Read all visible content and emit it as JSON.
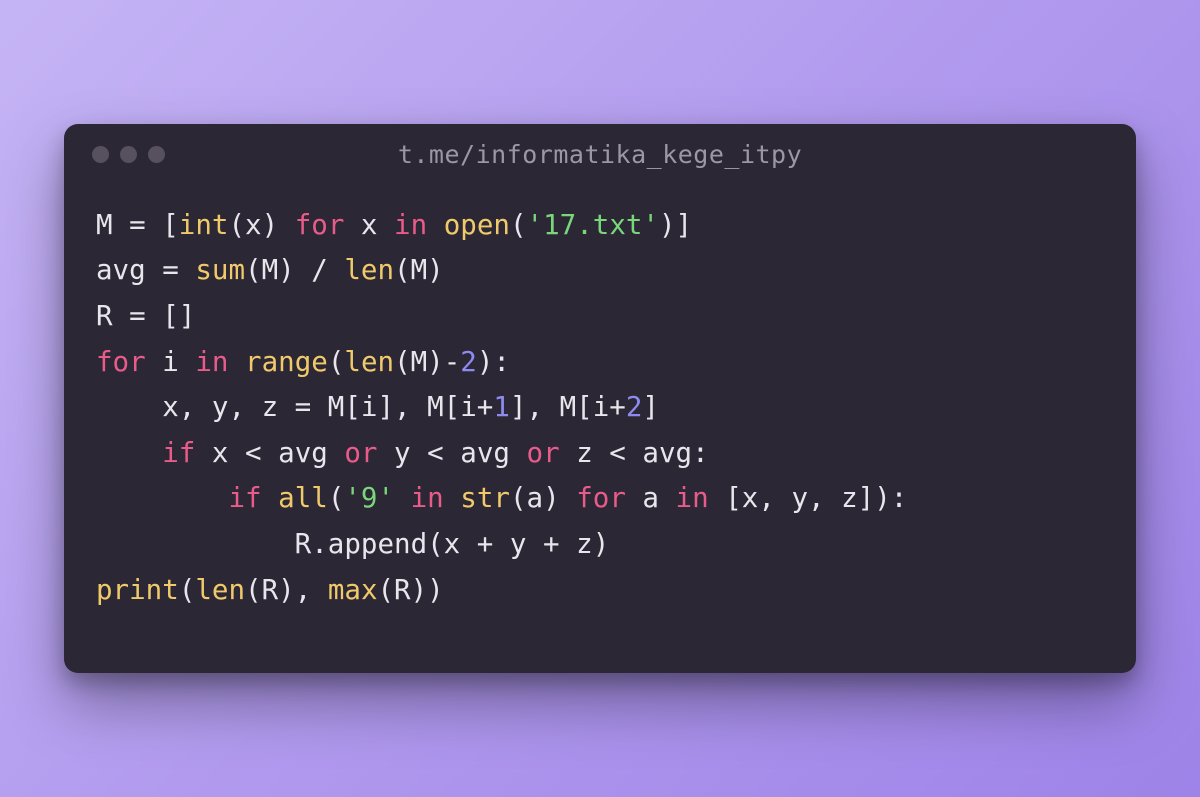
{
  "window": {
    "title": "t.me/informatika_kege_itpy"
  },
  "code": {
    "lines": [
      [
        {
          "t": "M = [",
          "c": "default"
        },
        {
          "t": "int",
          "c": "func"
        },
        {
          "t": "(x) ",
          "c": "default"
        },
        {
          "t": "for",
          "c": "keyword"
        },
        {
          "t": " x ",
          "c": "default"
        },
        {
          "t": "in",
          "c": "keyword"
        },
        {
          "t": " ",
          "c": "default"
        },
        {
          "t": "open",
          "c": "func"
        },
        {
          "t": "(",
          "c": "default"
        },
        {
          "t": "'17.txt'",
          "c": "string"
        },
        {
          "t": ")]",
          "c": "default"
        }
      ],
      [
        {
          "t": "avg = ",
          "c": "default"
        },
        {
          "t": "sum",
          "c": "func"
        },
        {
          "t": "(M) / ",
          "c": "default"
        },
        {
          "t": "len",
          "c": "func"
        },
        {
          "t": "(M)",
          "c": "default"
        }
      ],
      [
        {
          "t": "R = []",
          "c": "default"
        }
      ],
      [
        {
          "t": "for",
          "c": "keyword"
        },
        {
          "t": " i ",
          "c": "default"
        },
        {
          "t": "in",
          "c": "keyword"
        },
        {
          "t": " ",
          "c": "default"
        },
        {
          "t": "range",
          "c": "func"
        },
        {
          "t": "(",
          "c": "default"
        },
        {
          "t": "len",
          "c": "func"
        },
        {
          "t": "(M)-",
          "c": "default"
        },
        {
          "t": "2",
          "c": "number"
        },
        {
          "t": "):",
          "c": "default"
        }
      ],
      [
        {
          "t": "    x, y, z = M[i], M[i+",
          "c": "default"
        },
        {
          "t": "1",
          "c": "number"
        },
        {
          "t": "], M[i+",
          "c": "default"
        },
        {
          "t": "2",
          "c": "number"
        },
        {
          "t": "]",
          "c": "default"
        }
      ],
      [
        {
          "t": "    ",
          "c": "default"
        },
        {
          "t": "if",
          "c": "keyword"
        },
        {
          "t": " x < avg ",
          "c": "default"
        },
        {
          "t": "or",
          "c": "keyword"
        },
        {
          "t": " y < avg ",
          "c": "default"
        },
        {
          "t": "or",
          "c": "keyword"
        },
        {
          "t": " z < avg:",
          "c": "default"
        }
      ],
      [
        {
          "t": "        ",
          "c": "default"
        },
        {
          "t": "if",
          "c": "keyword"
        },
        {
          "t": " ",
          "c": "default"
        },
        {
          "t": "all",
          "c": "func"
        },
        {
          "t": "(",
          "c": "default"
        },
        {
          "t": "'9'",
          "c": "string"
        },
        {
          "t": " ",
          "c": "default"
        },
        {
          "t": "in",
          "c": "keyword"
        },
        {
          "t": " ",
          "c": "default"
        },
        {
          "t": "str",
          "c": "func"
        },
        {
          "t": "(a) ",
          "c": "default"
        },
        {
          "t": "for",
          "c": "keyword"
        },
        {
          "t": " a ",
          "c": "default"
        },
        {
          "t": "in",
          "c": "keyword"
        },
        {
          "t": " [x, y, z]):",
          "c": "default"
        }
      ],
      [
        {
          "t": "            R.append(x + y + z)",
          "c": "default"
        }
      ],
      [
        {
          "t": "print",
          "c": "func"
        },
        {
          "t": "(",
          "c": "default"
        },
        {
          "t": "len",
          "c": "func"
        },
        {
          "t": "(R), ",
          "c": "default"
        },
        {
          "t": "max",
          "c": "func"
        },
        {
          "t": "(R))",
          "c": "default"
        }
      ]
    ]
  }
}
